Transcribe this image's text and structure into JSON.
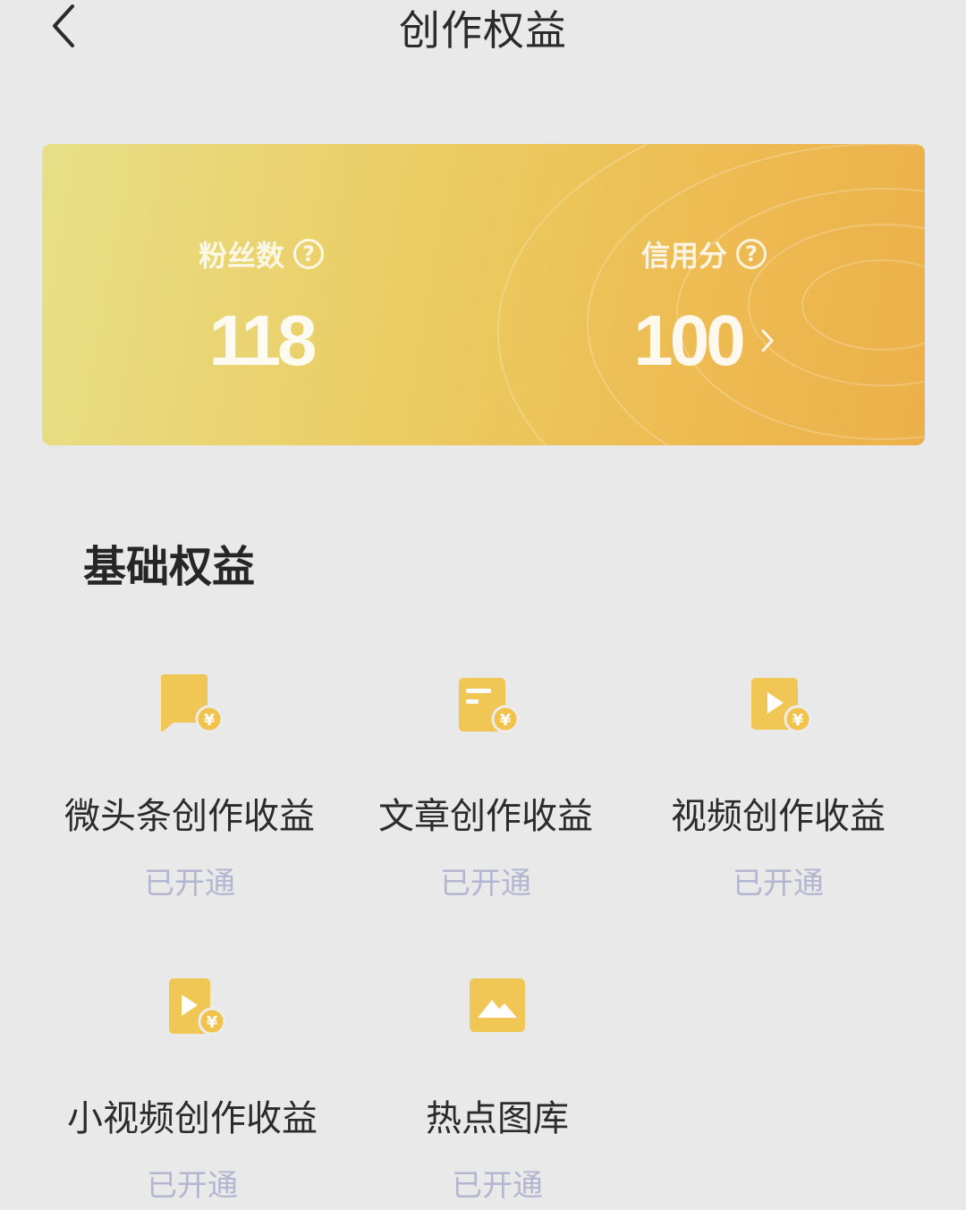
{
  "nav": {
    "title": "创作权益",
    "back_icon": "chevron-left-icon"
  },
  "stats_card": {
    "fans": {
      "label": "粉丝数",
      "value": "118",
      "help_icon": "question-circle-icon"
    },
    "credit": {
      "label": "信用分",
      "value": "100",
      "help_icon": "question-circle-icon",
      "arrow_icon": "chevron-right-icon"
    },
    "gradient_colors": [
      "#e8df88",
      "#ebcb60",
      "#edbb52",
      "#ecb04a"
    ]
  },
  "section": {
    "title": "基础权益"
  },
  "benefits": [
    {
      "icon": "chat-bubble-yen-icon",
      "name": "微头条创作收益",
      "status": "已开通"
    },
    {
      "icon": "article-yen-icon",
      "name": "文章创作收益",
      "status": "已开通"
    },
    {
      "icon": "video-yen-icon",
      "name": "视频创作收益",
      "status": "已开通"
    },
    {
      "icon": "small-video-yen-icon",
      "name": "小视频创作收益",
      "status": "已开通"
    },
    {
      "icon": "image-gallery-icon",
      "name": "热点图库",
      "status": "已开通"
    }
  ],
  "colors": {
    "icon_gold": "#f0c654",
    "status_text": "#b3b6d0",
    "background": "#e9e9e9"
  }
}
